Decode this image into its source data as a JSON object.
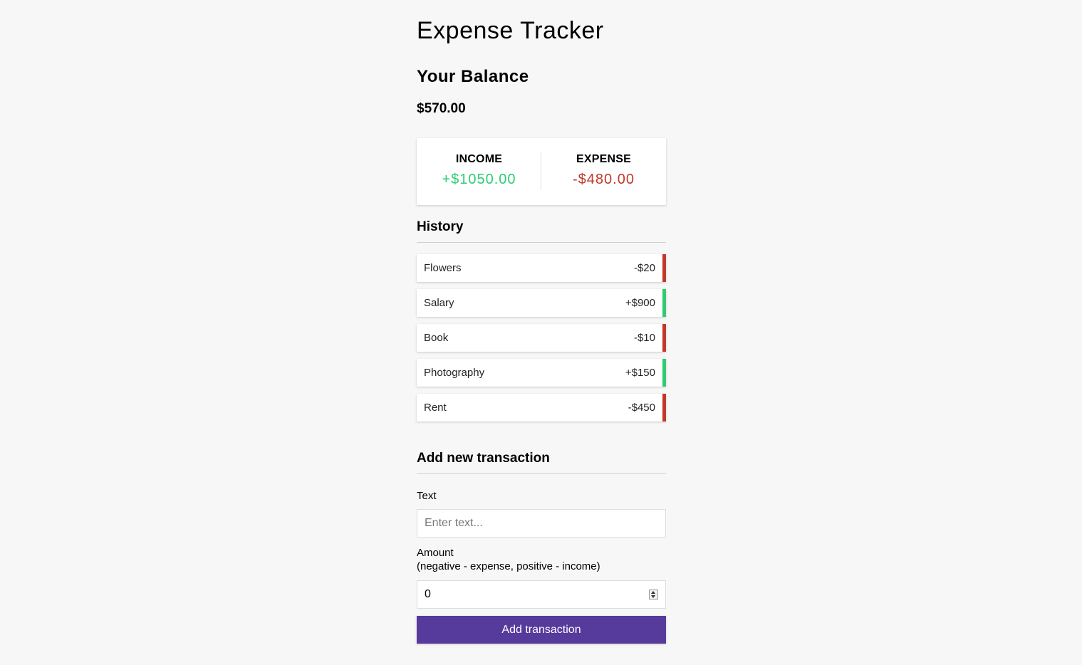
{
  "app": {
    "title": "Expense Tracker"
  },
  "balance": {
    "label": "Your Balance",
    "value": "$570.00"
  },
  "summary": {
    "income_label": "INCOME",
    "income_value": "+$1050.00",
    "expense_label": "EXPENSE",
    "expense_value": "-$480.00"
  },
  "history": {
    "title": "History",
    "items": [
      {
        "text": "Flowers",
        "amount": "-$20",
        "type": "minus"
      },
      {
        "text": "Salary",
        "amount": "+$900",
        "type": "plus"
      },
      {
        "text": "Book",
        "amount": "-$10",
        "type": "minus"
      },
      {
        "text": "Photography",
        "amount": "+$150",
        "type": "plus"
      },
      {
        "text": "Rent",
        "amount": "-$450",
        "type": "minus"
      }
    ]
  },
  "form": {
    "title": "Add new transaction",
    "text_label": "Text",
    "text_placeholder": "Enter text...",
    "amount_label": "Amount",
    "amount_hint": "(negative - expense, positive - income)",
    "amount_value": "0",
    "submit_label": "Add transaction"
  },
  "colors": {
    "income": "#2ecc71",
    "expense": "#c0392b",
    "button": "#563a9c",
    "background": "#f7f7f7"
  },
  "icons": {
    "amount_spinner": "number-spinner-icon"
  }
}
